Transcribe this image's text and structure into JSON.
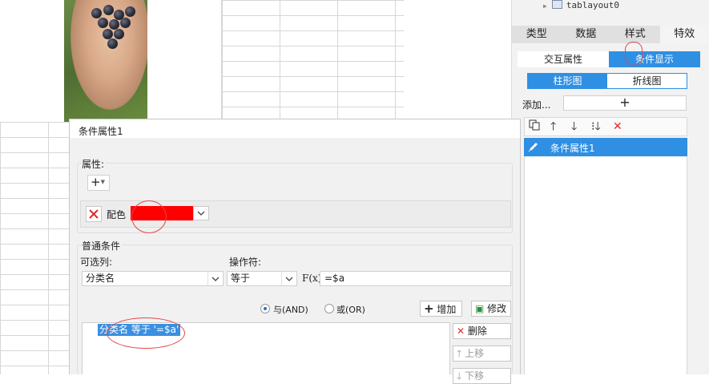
{
  "tree": {
    "layout_node": "tablayout0"
  },
  "right_panel": {
    "tabs": [
      "类型",
      "数据",
      "样式",
      "特效"
    ],
    "active_tab": "样式",
    "subtabs": [
      "交互属性",
      "条件显示"
    ],
    "active_subtab": "条件显示",
    "chart_tabs": [
      "柱形图",
      "折线图"
    ],
    "active_chart_tab": "柱形图",
    "add_label": "添加...",
    "add_button": "+",
    "condition_items": [
      "条件属性1"
    ]
  },
  "dialog": {
    "title": "条件属性1",
    "attributes": {
      "section_label": "属性:",
      "add_button": "+",
      "color_label": "配色",
      "color_value": "#ff0000"
    },
    "condition": {
      "section_label": "普通条件",
      "column_label": "可选列:",
      "column_value": "分类名",
      "operator_label": "操作符:",
      "operator_value": "等于",
      "formula_icon": "F(x)",
      "value": "=$a",
      "and_label": "与(AND)",
      "or_label": "或(OR)",
      "logic_selected": "and",
      "add_button": "增加",
      "edit_button": "修改",
      "delete_button": "删除",
      "up_button": "上移",
      "down_button": "下移",
      "entries": [
        "分类名 等于 '=$a'"
      ]
    }
  },
  "colors": {
    "accent": "#2f8fe3",
    "annotation": "#e04848"
  }
}
